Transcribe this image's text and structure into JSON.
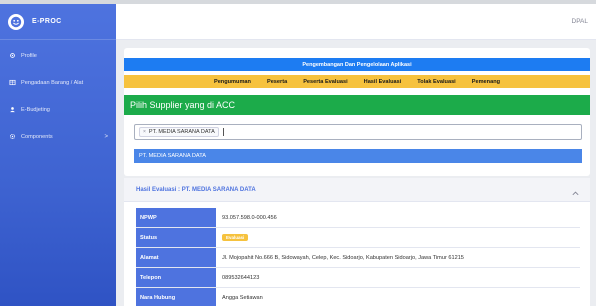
{
  "app": {
    "brand": "E-PROC",
    "user": "DPAL"
  },
  "sidebar": {
    "items": [
      {
        "label": "Profile",
        "icon": "gear-icon"
      },
      {
        "label": "Pengadaan Barang / Alat",
        "icon": "table-icon"
      },
      {
        "label": "E-Budjeting",
        "icon": "user-icon"
      },
      {
        "label": "Components",
        "icon": "cog-icon",
        "caret": ">"
      }
    ]
  },
  "header": {
    "title": "Pengembangan Dan Pengelolaan Aplikasi",
    "menu": [
      "Pengumuman",
      "Peserta",
      "Peserta Evaluasi",
      "Hasil Evaluasi",
      "Tolak Evaluasi",
      "Pemenang"
    ]
  },
  "selector": {
    "heading": "Pilih Supplier yang di ACC",
    "chip": "PT. MEDIA SARANA DATA",
    "chip_remove": "×",
    "option": "PT. MEDIA SARANA DATA"
  },
  "result": {
    "title": "Hasil Evaluasi : PT. MEDIA SARANA DATA",
    "rows": [
      {
        "label": "NPWP",
        "value": "93.057.598.0-000.456"
      },
      {
        "label": "Status",
        "badge": "Evaluasi"
      },
      {
        "label": "Alamat",
        "value": "Jl. Mojopahit No.666 B, Sidowayah, Celep, Kec. Sidoarjo, Kabupaten Sidoarjo, Jawa Timur 61215"
      },
      {
        "label": "Telepon",
        "value": "089532644123"
      },
      {
        "label": "Nara Hubung",
        "value": "Angga Setiawan"
      }
    ]
  },
  "colors": {
    "primary": "#4e73df",
    "title_bar": "#1d7cf2",
    "menu_bar": "#f6c23e",
    "green_bar": "#1cab4a"
  }
}
